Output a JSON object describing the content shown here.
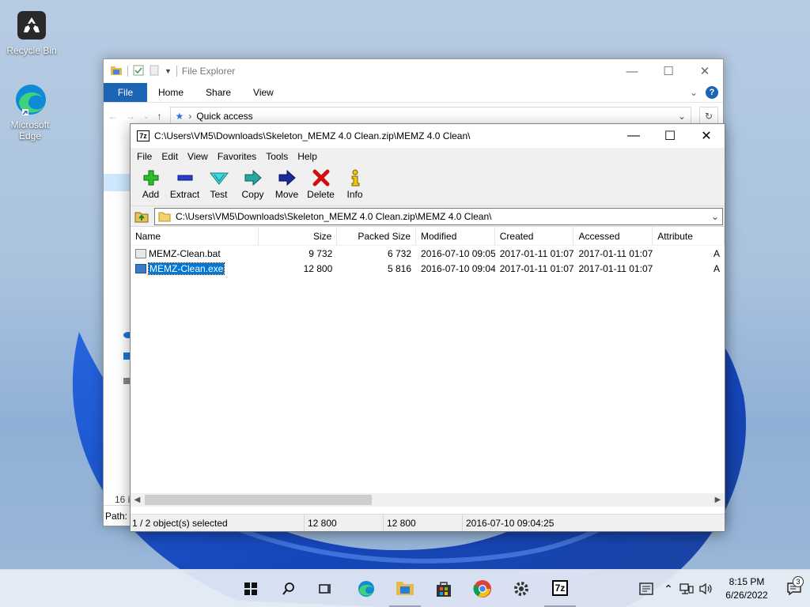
{
  "desktop": {
    "icons": [
      {
        "label": "Recycle Bin"
      },
      {
        "label": "Microsoft Edge"
      }
    ]
  },
  "file_explorer": {
    "title": "File Explorer",
    "ribbon_tabs": [
      "File",
      "Home",
      "Share",
      "View"
    ],
    "address": "Quick access",
    "item_count": "16 i",
    "path_label": "Path:"
  },
  "sevenzip": {
    "title": "C:\\Users\\VM5\\Downloads\\Skeleton_MEMZ 4.0 Clean.zip\\MEMZ 4.0 Clean\\",
    "menu": [
      "File",
      "Edit",
      "View",
      "Favorites",
      "Tools",
      "Help"
    ],
    "toolbar": [
      {
        "label": "Add",
        "icon": "add-icon"
      },
      {
        "label": "Extract",
        "icon": "extract-icon"
      },
      {
        "label": "Test",
        "icon": "test-icon"
      },
      {
        "label": "Copy",
        "icon": "copy-icon"
      },
      {
        "label": "Move",
        "icon": "move-icon"
      },
      {
        "label": "Delete",
        "icon": "delete-icon"
      },
      {
        "label": "Info",
        "icon": "info-icon"
      }
    ],
    "address": "C:\\Users\\VM5\\Downloads\\Skeleton_MEMZ 4.0 Clean.zip\\MEMZ 4.0 Clean\\",
    "columns": [
      "Name",
      "Size",
      "Packed Size",
      "Modified",
      "Created",
      "Accessed",
      "Attribute"
    ],
    "rows": [
      {
        "name": "MEMZ-Clean.bat",
        "size": "9 732",
        "packed": "6 732",
        "modified": "2016-07-10 09:05",
        "created": "2017-01-11 01:07",
        "accessed": "2017-01-11 01:07",
        "attr": "A",
        "selected": false
      },
      {
        "name": "MEMZ-Clean.exe",
        "size": "12 800",
        "packed": "5 816",
        "modified": "2016-07-10 09:04",
        "created": "2017-01-11 01:07",
        "accessed": "2017-01-11 01:07",
        "attr": "A",
        "selected": true
      }
    ],
    "status": {
      "selection": "1 / 2 object(s) selected",
      "size": "12 800",
      "packed": "12 800",
      "modified": "2016-07-10 09:04:25"
    }
  },
  "taskbar": {
    "time": "8:15 PM",
    "date": "6/26/2022",
    "notifications": "3",
    "seven_zip_label": "7z"
  },
  "colors": {
    "accent": "#0078d7",
    "ribbon_file": "#1c64b4"
  }
}
